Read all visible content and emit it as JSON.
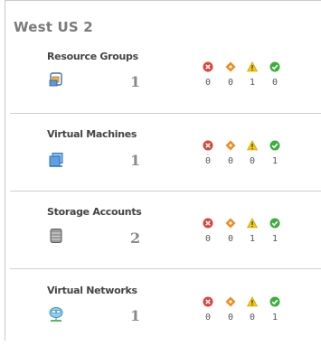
{
  "region": {
    "title": "West US 2"
  },
  "sections": [
    {
      "title": "Resource Groups",
      "icon": "resource-group-icon",
      "count": "1",
      "error": "0",
      "critical": "0",
      "warning": "1",
      "ok": "0"
    },
    {
      "title": "Virtual Machines",
      "icon": "virtual-machine-icon",
      "count": "1",
      "error": "0",
      "critical": "0",
      "warning": "0",
      "ok": "1"
    },
    {
      "title": "Storage Accounts",
      "icon": "storage-account-icon",
      "count": "2",
      "error": "0",
      "critical": "0",
      "warning": "1",
      "ok": "1"
    },
    {
      "title": "Virtual Networks",
      "icon": "virtual-network-icon",
      "count": "1",
      "error": "0",
      "critical": "0",
      "warning": "0",
      "ok": "1"
    }
  ],
  "status_icons": [
    "error-x-icon",
    "critical-diamond-icon",
    "warning-triangle-icon",
    "ok-check-icon"
  ],
  "colors": {
    "error": "#e0413a",
    "critical": "#f08a1c",
    "warning": "#f3c900",
    "ok": "#3cae3c",
    "title": "#7a7a7a"
  }
}
